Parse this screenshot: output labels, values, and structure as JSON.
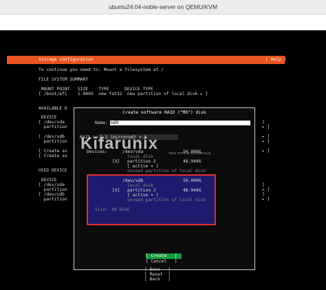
{
  "window": {
    "title": "ubuntu24.04-noble-server on QEMU/KVM"
  },
  "header": {
    "title": "Storage configuration",
    "help": "[ Help ]"
  },
  "intro": "To continue you need to: Mount a filesystem at /",
  "fs_summary": {
    "heading": "FILE SYSTEM SUMMARY",
    "columns": " MOUNT POINT   SIZE    TYPE      DEVICE TYPE",
    "row": "[ /boot/efi    1.049G  new fat32  new partition of local disk ▸ ]"
  },
  "available": {
    "heading": "AVAILABLE D",
    "device_col": " DEVICE",
    "rows": [
      "[ /dev/vda",
      "  partition",
      "[ /dev/vdb",
      "  partition"
    ],
    "actions": [
      "[ Create so",
      "[ Create so"
    ],
    "right_brackets": [
      "]",
      "▸ ]",
      "▸ ]",
      "▸ ]",
      "▸ ]"
    ]
  },
  "used": {
    "heading": "USED DEVICE",
    "device_col": " DEVICE",
    "rows": [
      "[ /dev/vda",
      "  partition",
      "[ /dev/vdb",
      "  partition"
    ],
    "right_brackets": [
      "]",
      "▸ ]",
      "]",
      "▸ ]"
    ]
  },
  "dialog": {
    "title": "Create software RAID (\"MD\") disk",
    "name_label": "Name:",
    "name_value": "md0",
    "raid_label": "RAID Level:",
    "raid_value": "[ 1 (mirrored) ▾ ]",
    "devices_label": "Devices:",
    "devices": [
      {
        "disk": "/dev/vda",
        "disk_size": "50.000G",
        "disk_desc": "local disk",
        "check": "[X]",
        "partition": "partition 2",
        "partition_size": "48.948G",
        "role": "[ active ▾ ]",
        "partition_desc": "unused partition of local disk"
      },
      {
        "disk": "/dev/vdb",
        "disk_size": "50.000G",
        "disk_desc": "local disk",
        "check": "[X]",
        "partition": "partition 2",
        "partition_size": "48.948G",
        "role": "[ active ▾ ]",
        "partition_desc": "unused partition of local disk"
      }
    ],
    "size_label": "Size:",
    "size_value": "48.916G",
    "create_label": "[ Create   ]",
    "cancel_label": "[ Cancel   ]"
  },
  "footer": {
    "done": "[ Done   ]",
    "reset": "[ Reset  ]",
    "back": "[ Back   ]"
  },
  "watermark": {
    "text": "Kifarunix",
    "sub": "*NIX TIPS & TUTORIALS"
  },
  "colors": {
    "accent": "#e95420",
    "button_green": "#139e3a",
    "selection_blue": "#1e1b6e",
    "highlight_red": "#e03030"
  }
}
